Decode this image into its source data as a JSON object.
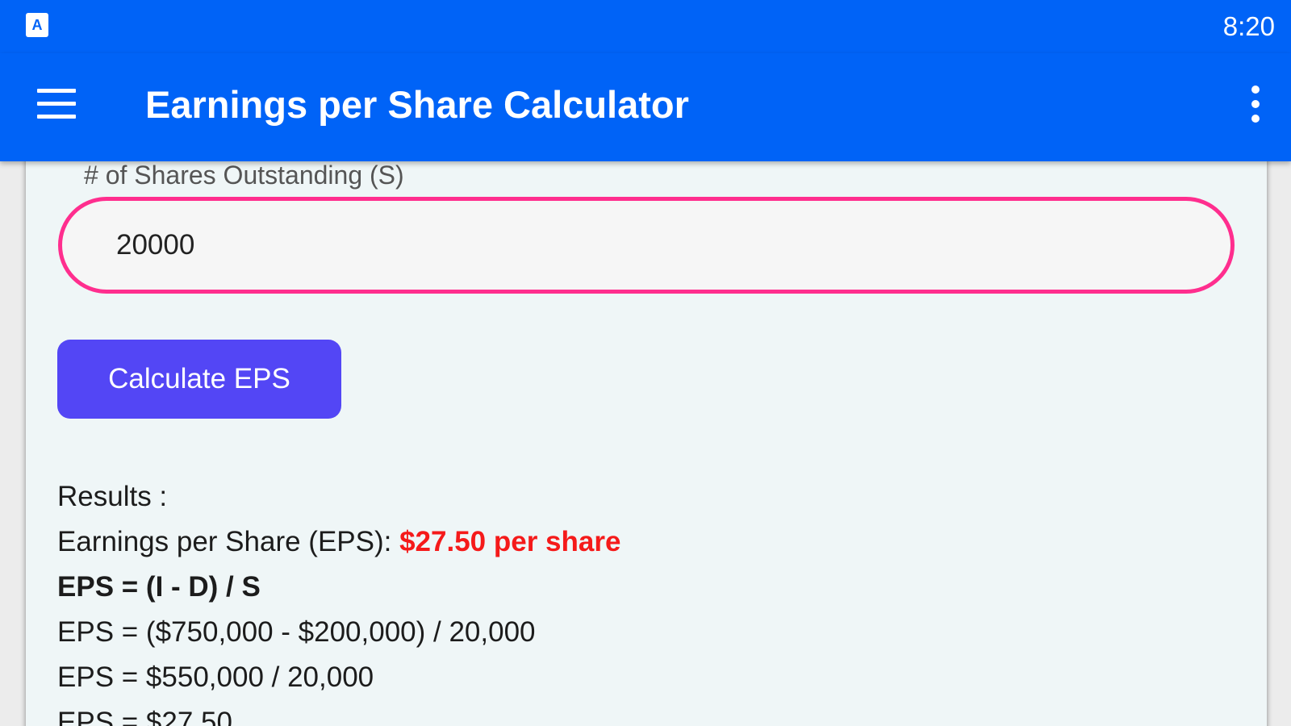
{
  "status_bar": {
    "app_icon_letter": "A",
    "time": "8:20"
  },
  "app_bar": {
    "title": "Earnings per Share Calculator",
    "menu_icon": "hamburger-menu-icon",
    "overflow_icon": "more-vert-icon"
  },
  "form": {
    "shares_label": "# of Shares Outstanding (S)",
    "shares_value": "20000",
    "calculate_button": "Calculate EPS"
  },
  "results": {
    "heading": "Results :",
    "eps_label": "Earnings per Share (EPS): ",
    "eps_value": "$27.50 per share",
    "formula": "EPS = (I - D) / S",
    "step1": "EPS = ($750,000 - $200,000) / 20,000",
    "step2": "EPS = $550,000 / 20,000",
    "step3": "EPS = $27.50"
  },
  "colors": {
    "primary": "#0063f7",
    "input_border": "#ff2e8e",
    "button": "#5346f5",
    "highlight": "#f51a1a",
    "card_background": "#eff6f7"
  }
}
